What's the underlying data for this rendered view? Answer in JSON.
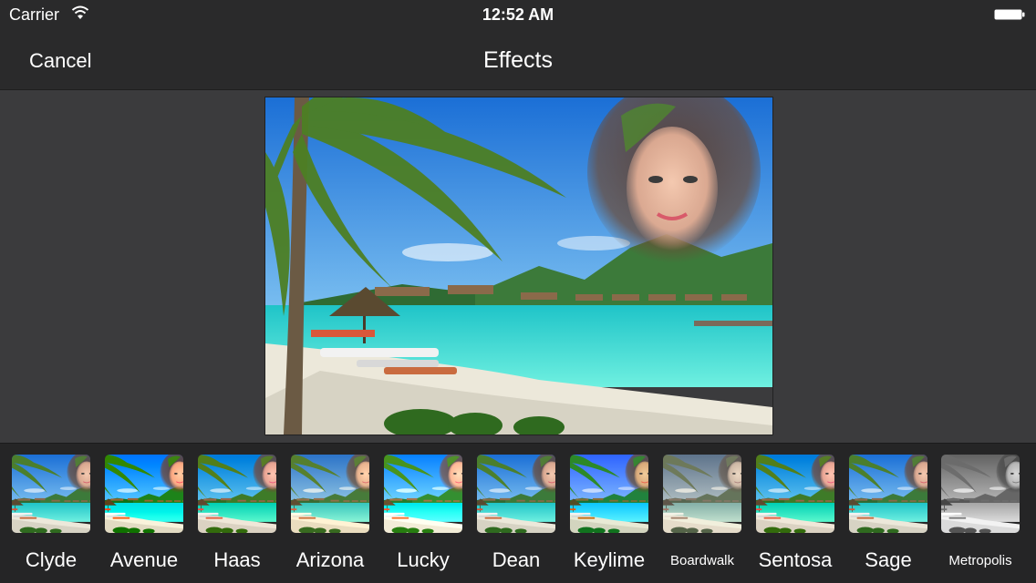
{
  "status_bar": {
    "carrier": "Carrier",
    "time": "12:52 AM",
    "wifi_icon": "wifi-icon",
    "battery_icon": "battery-icon"
  },
  "nav": {
    "cancel_label": "Cancel",
    "title": "Effects"
  },
  "effects": [
    {
      "label": "Clyde",
      "style": "normal"
    },
    {
      "label": "Avenue",
      "style": "vivid"
    },
    {
      "label": "Haas",
      "style": "cool"
    },
    {
      "label": "Arizona",
      "style": "warm"
    },
    {
      "label": "Lucky",
      "style": "bright"
    },
    {
      "label": "Dean",
      "style": "normal"
    },
    {
      "label": "Keylime",
      "style": "green"
    },
    {
      "label": "Boardwalk",
      "style": "faded"
    },
    {
      "label": "Sentosa",
      "style": "cool"
    },
    {
      "label": "Sage",
      "style": "normal"
    },
    {
      "label": "Metropolis",
      "style": "mono"
    }
  ],
  "colors": {
    "toolbar": "#2a2a2b",
    "background": "#3b3b3d",
    "strip": "#252526",
    "sky": "#3a8de0",
    "water": "#2fd3d0",
    "sand": "#e8e4d4",
    "palm": "#3e6b1e"
  }
}
